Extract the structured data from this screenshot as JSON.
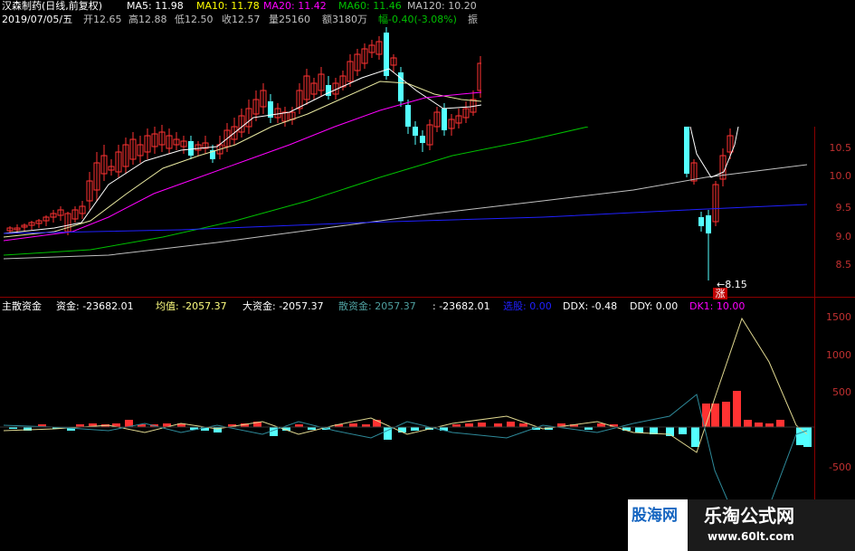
{
  "header": {
    "title": "汉森制药(日线,前复权)",
    "ma5": "MA5: 11.98",
    "ma10": "MA10: 11.78",
    "ma20": "MA20: 11.42",
    "ma60": "MA60: 11.46",
    "ma120": "MA120: 10.20",
    "date": "2019/07/05/五",
    "open": "开12.65",
    "high": "高12.88",
    "low": "低12.50",
    "close": "收12.57",
    "volume": "量25160",
    "amount": "额3180万",
    "change": "幅-0.40(-3.08%)",
    "amplitude": "振"
  },
  "price_axis": [
    "10.5",
    "10.0",
    "9.5",
    "9.0",
    "8.5"
  ],
  "low_marker": "8.15",
  "zhang_label": "涨",
  "indicator": {
    "name": "主散资金",
    "zijin": "资金: -23682.01",
    "junzhi": "均值: -2057.37",
    "dazijin": "大资金: -2057.37",
    "sanzijin": "散资金: 2057.37",
    "extra": ": -23682.01",
    "xuanfeng": "选股: 0.00",
    "ddx": "DDX: -0.48",
    "ddy": "DDY: 0.00",
    "dk1": "DK1: 10.00"
  },
  "indicator_axis": [
    "1500",
    "1000",
    "500",
    "-500"
  ],
  "watermark": {
    "left": "股海网",
    "right_title": "乐淘公式网",
    "right_url": "www.60lt.com"
  },
  "colors": {
    "up": "#ff3232",
    "down": "#54ffff",
    "ma5": "#ffffff",
    "ma10": "#ffff00",
    "ma20": "#ff00ff",
    "ma60": "#00c000",
    "ma120": "#c0c0c0",
    "blue": "#2020ff"
  }
}
